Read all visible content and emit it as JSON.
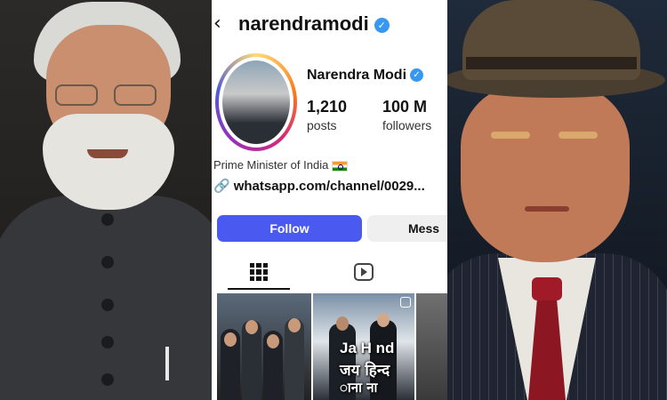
{
  "profile": {
    "handle": "narendramodi",
    "display_name": "Narendra Modi",
    "verified": true,
    "stats": [
      {
        "count": "1,210",
        "label": "posts"
      },
      {
        "count": "100 M",
        "label": "followers"
      }
    ],
    "bio": "Prime Minister of India",
    "link": "whatsapp.com/channel/0029..."
  },
  "actions": {
    "follow_label": "Follow",
    "message_label": "Mess"
  },
  "tabs": [
    {
      "icon": "grid-icon",
      "active": true
    },
    {
      "icon": "reels-icon",
      "active": false
    }
  ],
  "posts": {
    "caption_lines": [
      "Ja H nd",
      "जय हिन्द",
      "ाना ना"
    ]
  },
  "colors": {
    "follow_button": "#4a5af0",
    "verified": "#3897f0",
    "tie": "#8c1622"
  }
}
